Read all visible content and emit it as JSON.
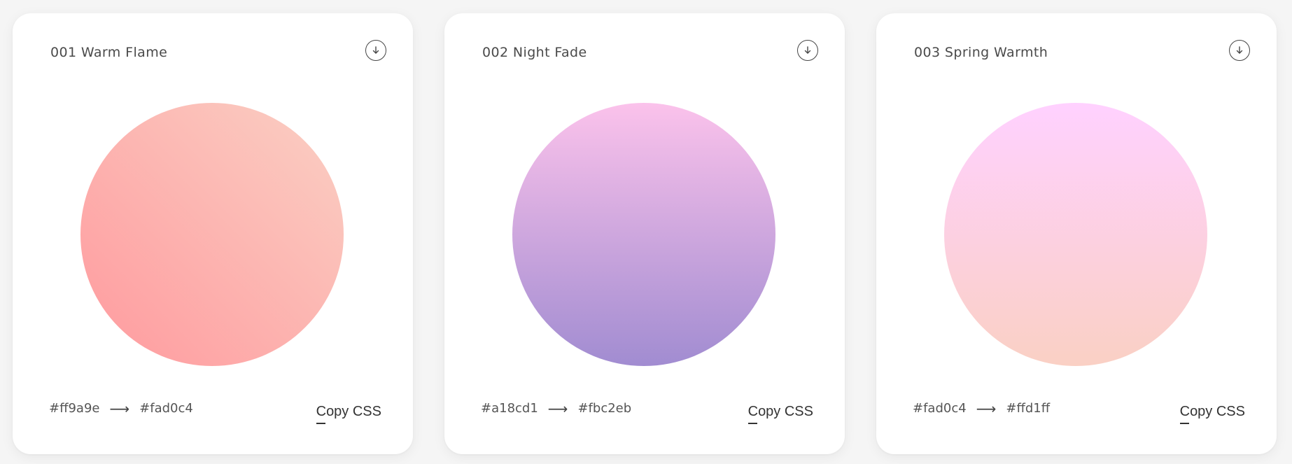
{
  "gradients": [
    {
      "title": "001 Warm Flame",
      "from": "#ff9a9e",
      "to": "#fad0c4",
      "direction": "diagonal",
      "copy_label": "Copy CSS",
      "arrow": "⟶"
    },
    {
      "title": "002 Night Fade",
      "from": "#a18cd1",
      "to": "#fbc2eb",
      "direction": "vertical",
      "copy_label": "Copy CSS",
      "arrow": "⟶"
    },
    {
      "title": "003 Spring Warmth",
      "from": "#fad0c4",
      "to": "#ffd1ff",
      "direction": "vertical",
      "copy_label": "Copy CSS",
      "arrow": "⟶"
    }
  ],
  "icons": {
    "download": "download-arrow-icon"
  }
}
